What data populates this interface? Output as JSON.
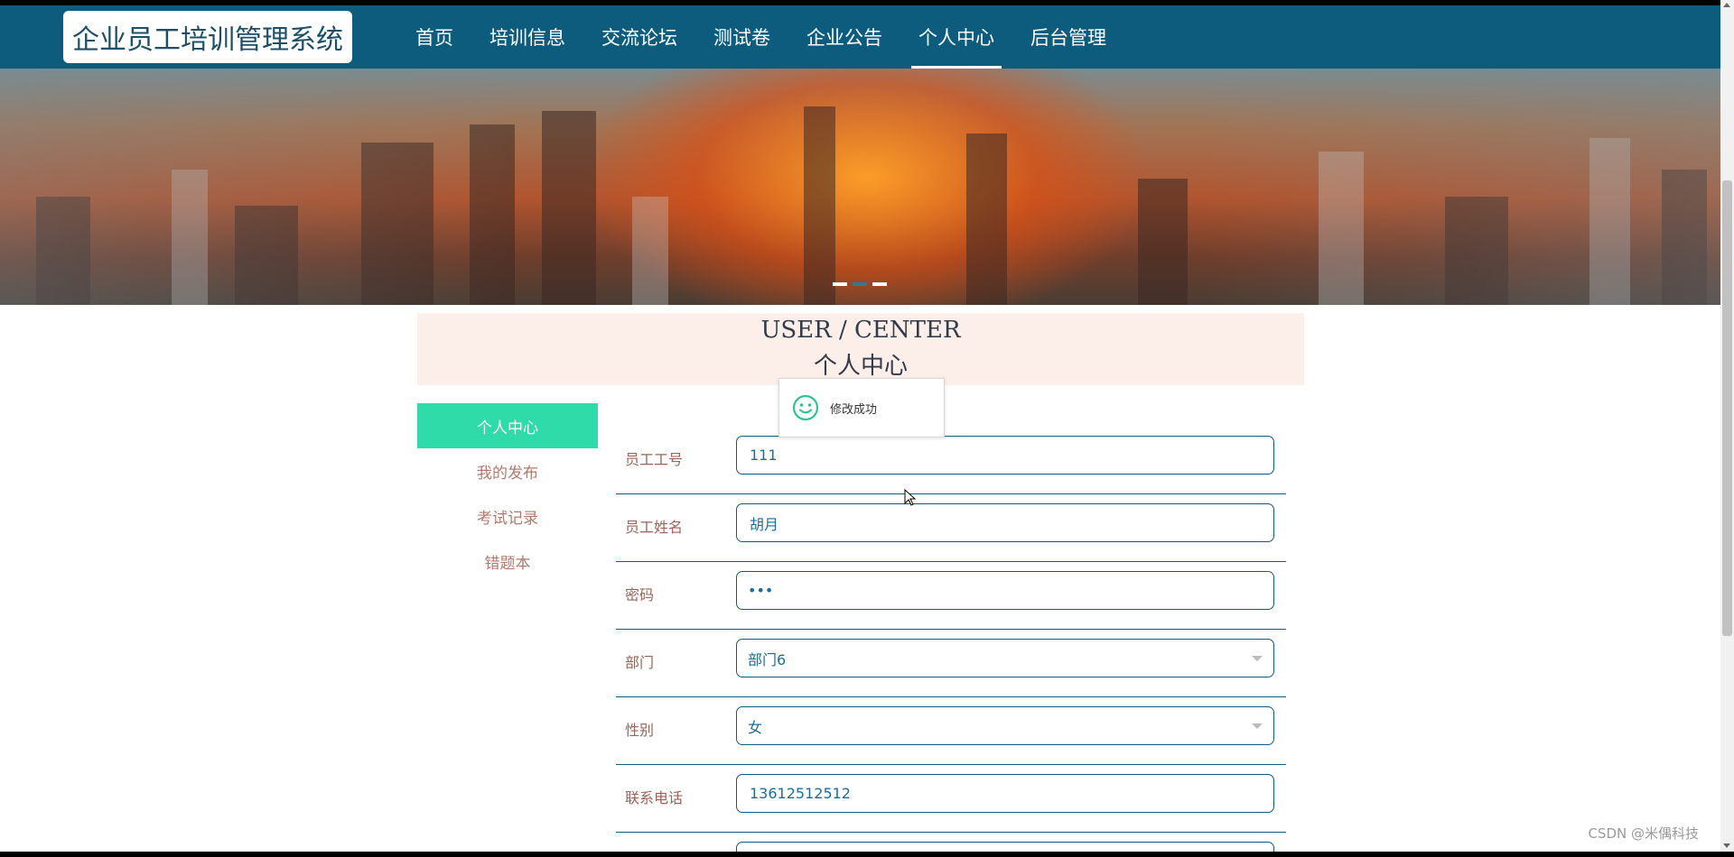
{
  "header": {
    "logo": "企业员工培训管理系统",
    "nav": [
      {
        "label": "首页"
      },
      {
        "label": "培训信息"
      },
      {
        "label": "交流论坛"
      },
      {
        "label": "测试卷"
      },
      {
        "label": "企业公告"
      },
      {
        "label": "个人中心",
        "active": true
      },
      {
        "label": "后台管理"
      }
    ]
  },
  "banner": {
    "image": "city-sunset-skyline",
    "active_slide": 2,
    "slide_count": 3
  },
  "section": {
    "title_en": "USER / CENTER",
    "title_cn": "个人中心"
  },
  "sidebar": {
    "items": [
      {
        "label": "个人中心",
        "active": true
      },
      {
        "label": "我的发布"
      },
      {
        "label": "考试记录"
      },
      {
        "label": "错题本"
      }
    ]
  },
  "form": {
    "fields": [
      {
        "label": "员工工号",
        "value": "111",
        "type": "text"
      },
      {
        "label": "员工姓名",
        "value": "胡月",
        "type": "text"
      },
      {
        "label": "密码",
        "value": "•••",
        "type": "password"
      },
      {
        "label": "部门",
        "value": "部门6",
        "type": "select"
      },
      {
        "label": "性别",
        "value": "女",
        "type": "select"
      },
      {
        "label": "联系电话",
        "value": "13612512512",
        "type": "text"
      }
    ]
  },
  "toast": {
    "icon": "smile-icon",
    "message": "修改成功"
  },
  "watermark": "CSDN @米偶科技",
  "colors": {
    "nav_bg": "#0d5c7e",
    "sidebar_active": "#2fdba8",
    "header_panel": "#fcefe9",
    "label_text": "#9a6558",
    "input_text": "#1d6d96"
  }
}
